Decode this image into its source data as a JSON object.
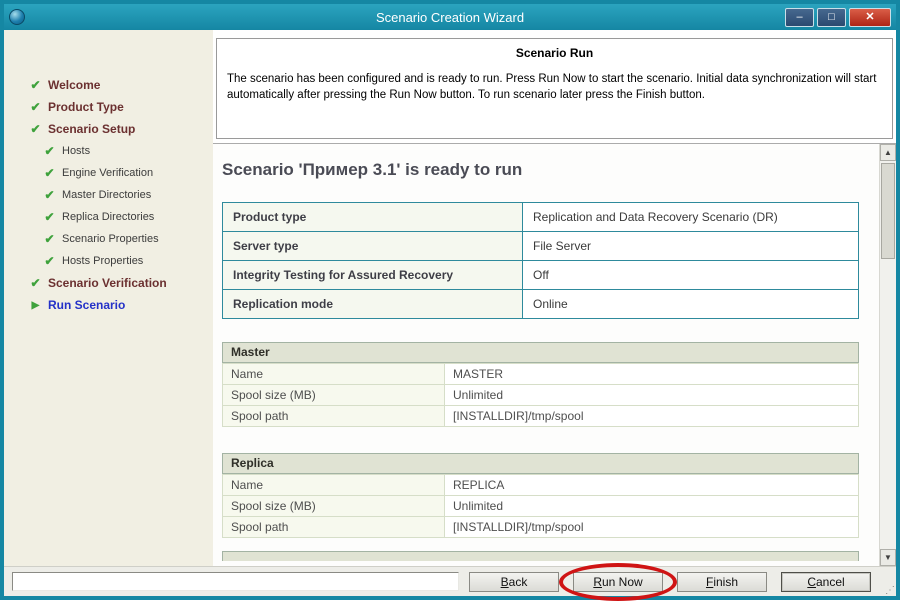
{
  "window": {
    "title": "Scenario Creation Wizard",
    "controls": {
      "minimize": "–",
      "maximize": "□",
      "close": "✕"
    }
  },
  "icons": {
    "completed_step": "✔",
    "current_step": "▶",
    "scroll_up": "▲",
    "scroll_down": "▼",
    "resize_grip": "⋰"
  },
  "sidebar": {
    "items": [
      {
        "label": "Welcome",
        "level": 0,
        "state": "done"
      },
      {
        "label": "Product Type",
        "level": 0,
        "state": "done"
      },
      {
        "label": "Scenario Setup",
        "level": 0,
        "state": "done"
      },
      {
        "label": "Hosts",
        "level": 1,
        "state": "done"
      },
      {
        "label": "Engine Verification",
        "level": 1,
        "state": "done"
      },
      {
        "label": "Master Directories",
        "level": 1,
        "state": "done"
      },
      {
        "label": "Replica Directories",
        "level": 1,
        "state": "done"
      },
      {
        "label": "Scenario Properties",
        "level": 1,
        "state": "done"
      },
      {
        "label": "Hosts Properties",
        "level": 1,
        "state": "done"
      },
      {
        "label": "Scenario Verification",
        "level": 0,
        "state": "done"
      },
      {
        "label": "Run Scenario",
        "level": 0,
        "state": "current"
      }
    ]
  },
  "info_panel": {
    "title": "Scenario Run",
    "description": "The scenario has been configured and is ready to run. Press Run Now to start the scenario. Initial data synchronization will start automatically after pressing the Run Now button. To run scenario later press the Finish button."
  },
  "content": {
    "heading": "Scenario 'Пример 3.1' is ready to run",
    "summary_table": {
      "rows": [
        {
          "label": "Product type",
          "value": "Replication and Data Recovery Scenario (DR)"
        },
        {
          "label": "Server type",
          "value": "File Server"
        },
        {
          "label": "Integrity Testing for Assured Recovery",
          "value": "Off"
        },
        {
          "label": "Replication mode",
          "value": "Online"
        }
      ]
    },
    "host_tables": [
      {
        "title": "Master",
        "rows": [
          {
            "label": "Name",
            "value": "MASTER"
          },
          {
            "label": "Spool size (MB)",
            "value": "Unlimited"
          },
          {
            "label": "Spool path",
            "value": "[INSTALLDIR]/tmp/spool"
          }
        ]
      },
      {
        "title": "Replica",
        "rows": [
          {
            "label": "Name",
            "value": "REPLICA"
          },
          {
            "label": "Spool size (MB)",
            "value": "Unlimited"
          },
          {
            "label": "Spool path",
            "value": "[INSTALLDIR]/tmp/spool"
          }
        ]
      }
    ]
  },
  "footer": {
    "buttons": [
      {
        "label": "Back",
        "accel": "B"
      },
      {
        "label": "Run Now",
        "accel": "R",
        "highlighted": true
      },
      {
        "label": "Finish",
        "accel": "F"
      },
      {
        "label": "Cancel",
        "accel": "C",
        "default": true
      }
    ]
  }
}
